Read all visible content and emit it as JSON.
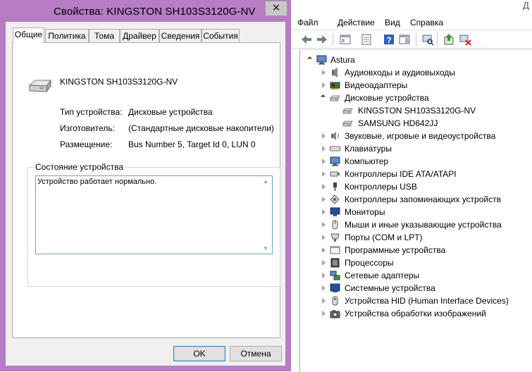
{
  "dialog": {
    "title": "Свойства: KINGSTON SH103S3120G-NV",
    "close_glyph": "✕",
    "tabs": [
      "Общие",
      "Политика",
      "Тома",
      "Драйвер",
      "Сведения",
      "События"
    ],
    "device_name": "KINGSTON SH103S3120G-NV",
    "props": [
      {
        "label": "Тип устройства:",
        "value": "Дисковые устройства"
      },
      {
        "label": "Изготовитель:",
        "value": "(Стандартные дисковые накопители)"
      },
      {
        "label": "Размещение:",
        "value": "Bus Number 5, Target Id 0, LUN 0"
      }
    ],
    "status_group_label": "Состояние устройства",
    "status_text": "Устройство работает нормально.",
    "ok_label": "OK",
    "cancel_label": "Отмена"
  },
  "device_manager": {
    "caption_partial": "Д",
    "menu": [
      "Файл",
      "Действие",
      "Вид",
      "Справка"
    ],
    "toolbar_icons": [
      "back-arrow-icon",
      "forward-arrow-icon",
      "show-hide-tree-icon",
      "properties-icon",
      "help-icon",
      "action-pane-icon",
      "scan-hardware-icon",
      "update-driver-icon",
      "uninstall-icon"
    ],
    "root": "Astura",
    "categories": [
      {
        "label": "Аудиовходы и аудиовыходы",
        "icon": "speaker-icon",
        "expanded": false
      },
      {
        "label": "Видеоадаптеры",
        "icon": "display-adapter-icon",
        "expanded": false
      },
      {
        "label": "Дисковые устройства",
        "icon": "disk-drive-icon",
        "expanded": true,
        "children": [
          "KINGSTON SH103S3120G-NV",
          "SAMSUNG HD642JJ"
        ]
      },
      {
        "label": "Звуковые, игровые и видеоустройства",
        "icon": "sound-icon",
        "expanded": false
      },
      {
        "label": "Клавиатуры",
        "icon": "keyboard-icon",
        "expanded": false
      },
      {
        "label": "Компьютер",
        "icon": "computer-icon",
        "expanded": false
      },
      {
        "label": "Контроллеры IDE ATA/ATAPI",
        "icon": "ide-controller-icon",
        "expanded": false
      },
      {
        "label": "Контроллеры USB",
        "icon": "usb-icon",
        "expanded": false
      },
      {
        "label": "Контроллеры запоминающих устройств",
        "icon": "storage-controller-icon",
        "expanded": false
      },
      {
        "label": "Мониторы",
        "icon": "monitor-icon",
        "expanded": false
      },
      {
        "label": "Мыши и иные указывающие устройства",
        "icon": "mouse-icon",
        "expanded": false
      },
      {
        "label": "Порты (COM и LPT)",
        "icon": "port-icon",
        "expanded": false
      },
      {
        "label": "Программные устройства",
        "icon": "software-device-icon",
        "expanded": false
      },
      {
        "label": "Процессоры",
        "icon": "processor-icon",
        "expanded": false
      },
      {
        "label": "Сетевые адаптеры",
        "icon": "network-adapter-icon",
        "expanded": false
      },
      {
        "label": "Системные устройства",
        "icon": "system-device-icon",
        "expanded": false
      },
      {
        "label": "Устройства HID (Human Interface Devices)",
        "icon": "hid-icon",
        "expanded": false
      },
      {
        "label": "Устройства обработки изображений",
        "icon": "imaging-device-icon",
        "expanded": false
      }
    ]
  },
  "colors": {
    "dialog_frame": "#b67cc4",
    "client_bg": "#f0f0f0",
    "status_border": "#7a9cc8"
  }
}
